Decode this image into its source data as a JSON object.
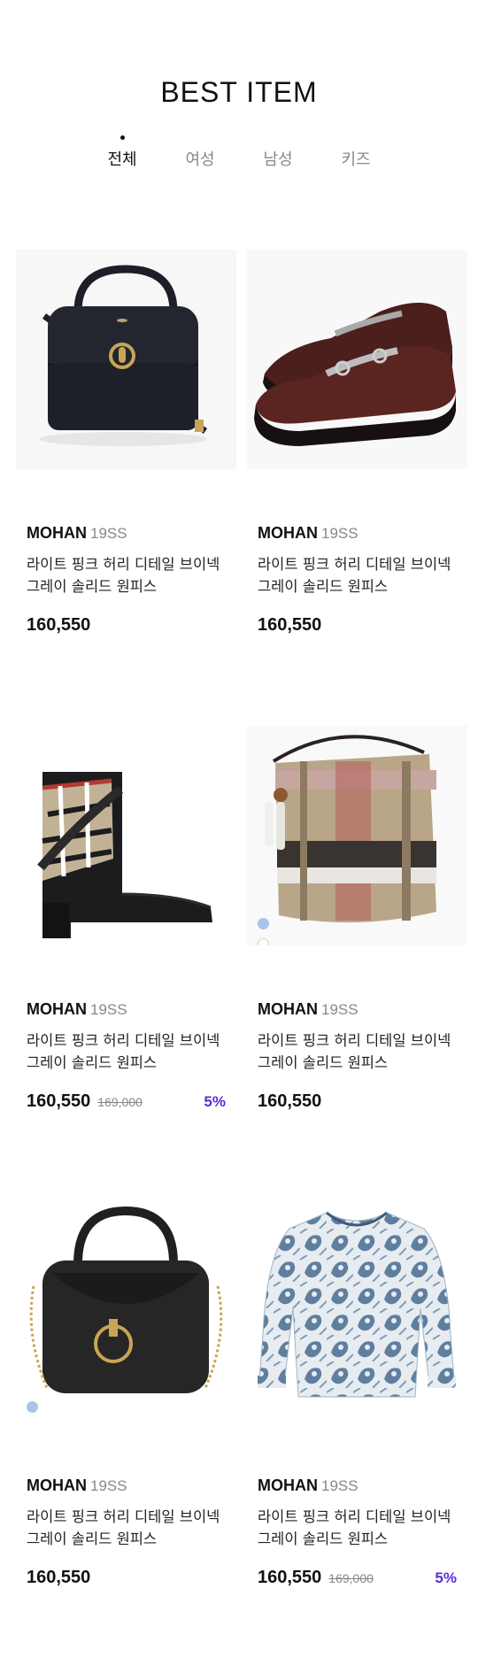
{
  "section": {
    "title": "BEST ITEM"
  },
  "tabs": [
    {
      "label": "전체",
      "active": true
    },
    {
      "label": "여성",
      "active": false
    },
    {
      "label": "남성",
      "active": false
    },
    {
      "label": "키즈",
      "active": false
    }
  ],
  "products": [
    {
      "image": "black-handbag",
      "brand": "MOHAN",
      "season": "19SS",
      "name": "라이트 핑크 허리 디테일 브이넥 그레이 솔리드 원피스",
      "price": "160,550",
      "original_price": "",
      "discount": "",
      "colors": []
    },
    {
      "image": "brown-loafers",
      "brand": "MOHAN",
      "season": "19SS",
      "name": "라이트 핑크 허리 디테일 브이넥 그레이 솔리드 원피스",
      "price": "160,550",
      "original_price": "",
      "discount": "",
      "colors": []
    },
    {
      "image": "check-ankle-boot",
      "brand": "MOHAN",
      "season": "19SS",
      "name": "라이트 핑크 허리 디테일 브이넥 그레이 솔리드 원피스",
      "price": "160,550",
      "original_price": "169,000",
      "discount": "5%",
      "colors": []
    },
    {
      "image": "check-bucket-bag",
      "brand": "MOHAN",
      "season": "19SS",
      "name": "라이트 핑크 허리 디테일 브이넥 그레이 솔리드 원피스",
      "price": "160,550",
      "original_price": "",
      "discount": "",
      "colors": [
        "#a8c4ea",
        "#ffffff",
        "#111111"
      ]
    },
    {
      "image": "black-ring-bag",
      "brand": "MOHAN",
      "season": "19SS",
      "name": "라이트 핑크 허리 디테일 브이넥 그레이 솔리드 원피스",
      "price": "160,550",
      "original_price": "",
      "discount": "",
      "colors": [
        "#a8c4ea",
        "#ffffff",
        "#111111"
      ]
    },
    {
      "image": "paisley-blouse",
      "brand": "MOHAN",
      "season": "19SS",
      "name": "라이트 핑크 허리 디테일 브이넥 그레이 솔리드 원피스",
      "price": "160,550",
      "original_price": "169,000",
      "discount": "5%",
      "colors": []
    }
  ],
  "theme": {
    "accent": "#5b2bd6",
    "text": "#111111",
    "muted": "#888888"
  }
}
